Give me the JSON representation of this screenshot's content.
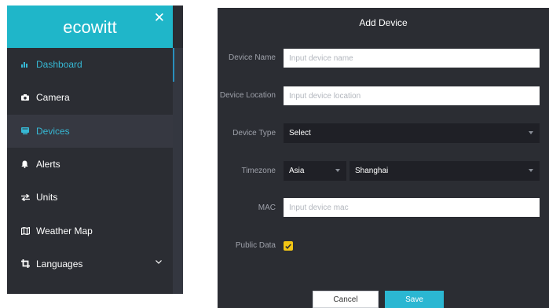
{
  "sidebar": {
    "brand": "ecowitt",
    "close_icon": "close-icon",
    "items": [
      {
        "label": "Dashboard",
        "icon": "dashboard-chart-icon",
        "highlighted": true
      },
      {
        "label": "Camera",
        "icon": "camera-icon",
        "highlighted": false
      },
      {
        "label": "Devices",
        "icon": "devices-icon",
        "highlighted": true,
        "active_background": true
      },
      {
        "label": "Alerts",
        "icon": "bell-icon",
        "highlighted": false
      },
      {
        "label": "Units",
        "icon": "swap-arrows-icon",
        "highlighted": false
      },
      {
        "label": "Weather Map",
        "icon": "map-icon",
        "highlighted": false
      },
      {
        "label": "Languages",
        "icon": "crop-icon",
        "highlighted": false,
        "has_dropdown": true
      }
    ]
  },
  "dialog": {
    "title": "Add Device",
    "device_name": {
      "label": "Device Name",
      "placeholder": "Input device name",
      "value": ""
    },
    "device_location": {
      "label": "Device Location",
      "placeholder": "Input device location",
      "value": ""
    },
    "device_type": {
      "label": "Device Type",
      "selected": "Select"
    },
    "timezone": {
      "label": "Timezone",
      "region": "Asia",
      "city": "Shanghai"
    },
    "mac": {
      "label": "MAC",
      "placeholder": "Input device mac",
      "value": ""
    },
    "public_data": {
      "label": "Public Data",
      "checked": true
    },
    "cancel_label": "Cancel",
    "save_label": "Save"
  },
  "colors": {
    "brand": "#1fb6c9",
    "sidebar_bg": "#2b2d33",
    "nav_highlight": "#36b8d4",
    "checkbox": "#f2c614",
    "save_button": "#2bb7d2"
  }
}
